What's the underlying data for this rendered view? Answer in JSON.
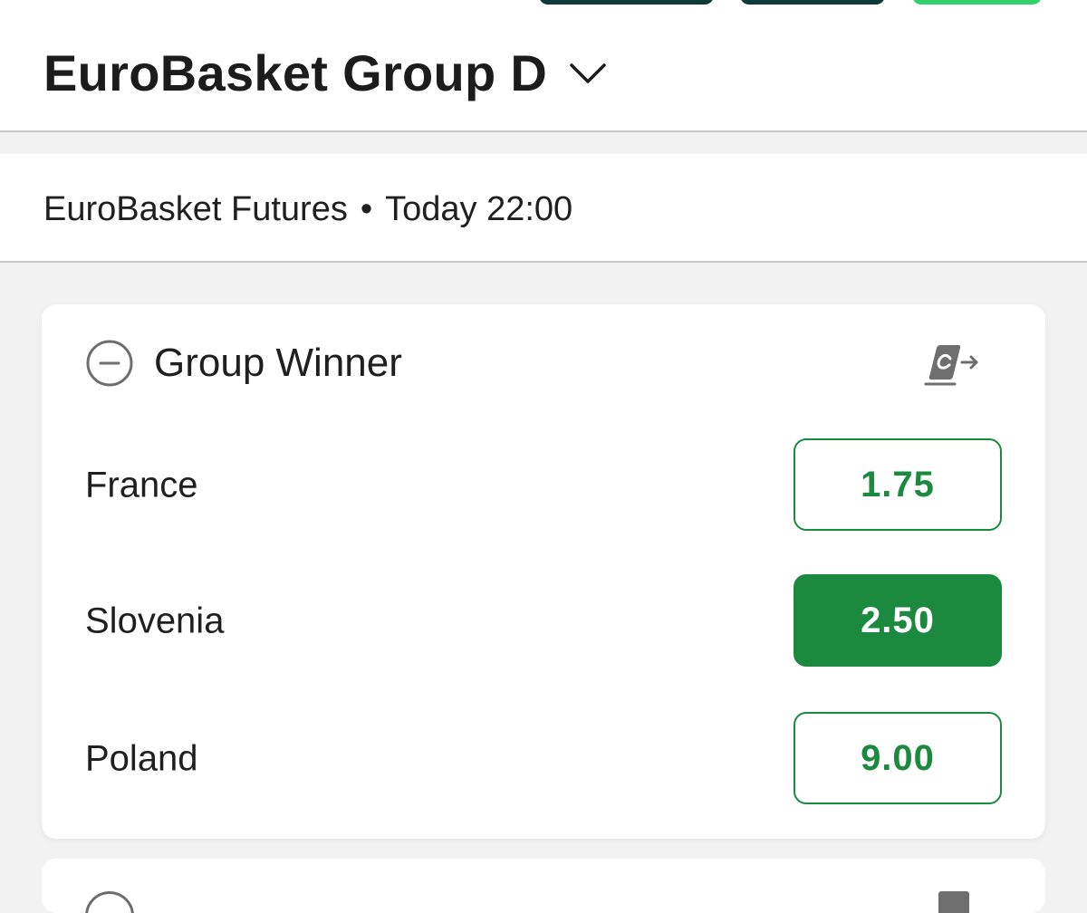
{
  "header": {
    "title": "EuroBasket Group D",
    "chevron_icon": "chevron-down-icon"
  },
  "event": {
    "competition": "EuroBasket Futures",
    "separator": "•",
    "time": "Today 22:00"
  },
  "market": {
    "title": "Group Winner",
    "collapse_icon": "minus-circle-icon",
    "cashout_icon": "cash-out-icon",
    "selections": [
      {
        "name": "France",
        "odds": "1.75",
        "selected": false
      },
      {
        "name": "Slovenia",
        "odds": "2.50",
        "selected": true
      },
      {
        "name": "Poland",
        "odds": "9.00",
        "selected": false
      }
    ]
  },
  "colors": {
    "accent": "#1b8a3f",
    "header_pill_dark": "#0e3b3a",
    "header_pill_bright": "#31d26b",
    "background": "#f2f2f2"
  }
}
